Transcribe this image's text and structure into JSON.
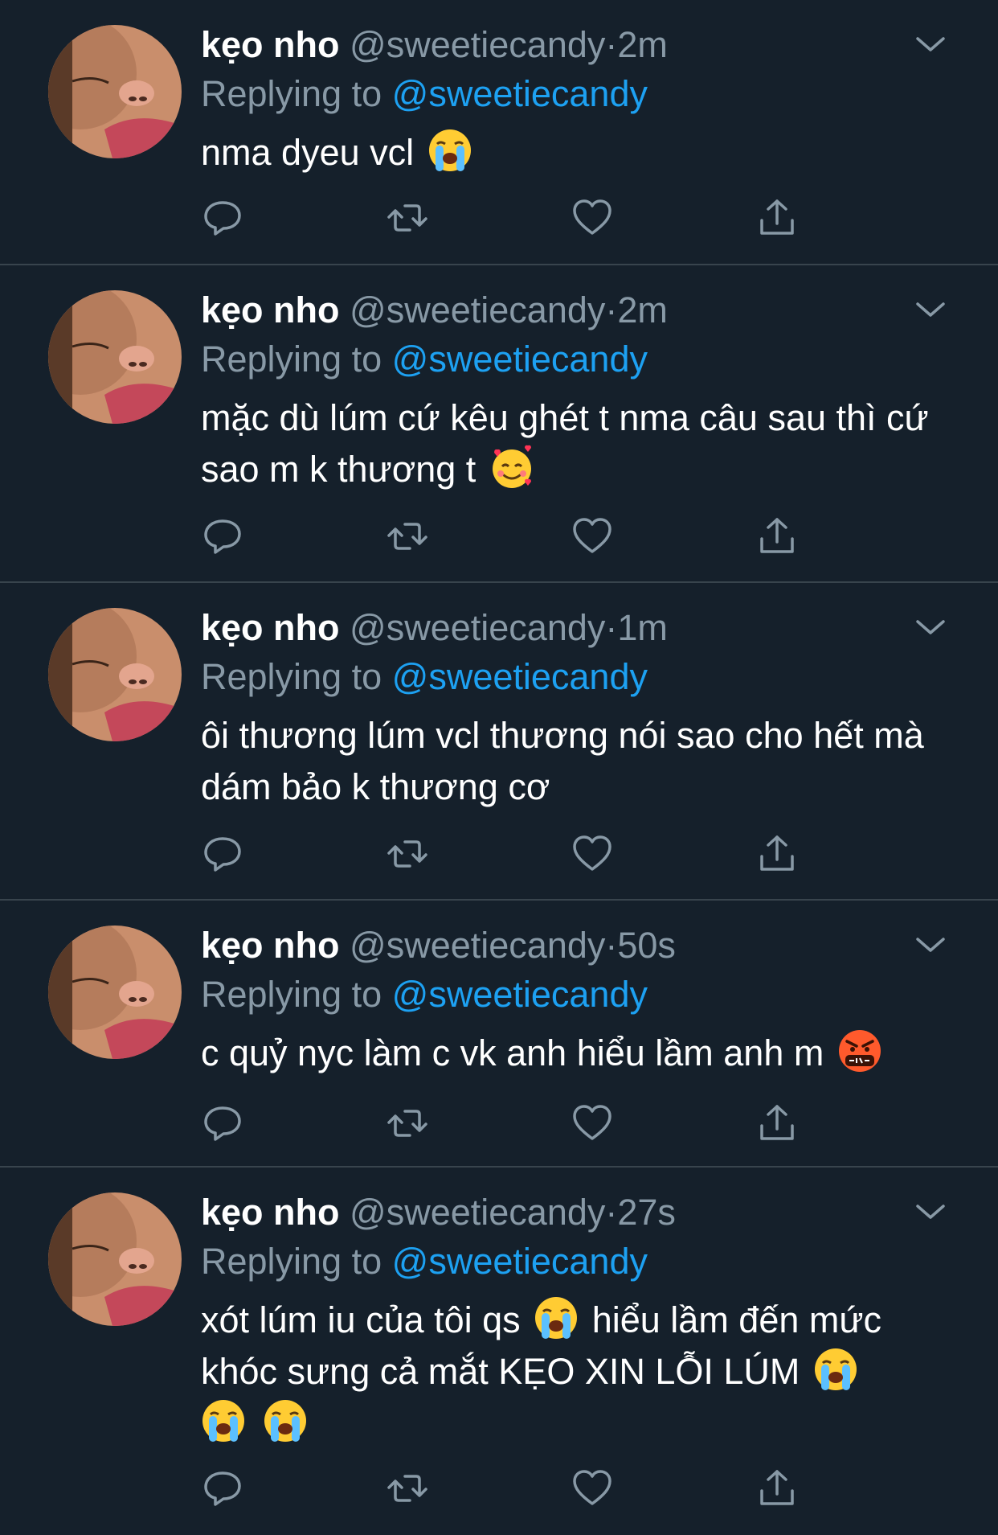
{
  "colors": {
    "background": "#15202b",
    "divider": "#38444d",
    "muted_text": "#8899a6",
    "link": "#1da1f2",
    "text": "#ffffff"
  },
  "tweets": [
    {
      "name": "kẹo nho",
      "handle": "@sweetiecandy",
      "separator": "·",
      "time": "2m",
      "replying_prefix": "Replying to ",
      "replying_to": "@sweetiecandy",
      "text_parts": [
        "nma dyeu vcl"
      ],
      "emojis": [
        "loudly-crying-face-emoji"
      ]
    },
    {
      "name": "kẹo nho",
      "handle": "@sweetiecandy",
      "separator": "·",
      "time": "2m",
      "replying_prefix": "Replying to ",
      "replying_to": "@sweetiecandy",
      "text_parts": [
        "mặc dù lúm cứ kêu ghét t nma câu sau thì cứ sao m k thương t"
      ],
      "emojis": [
        "smiling-face-with-hearts-emoji"
      ]
    },
    {
      "name": "kẹo nho",
      "handle": "@sweetiecandy",
      "separator": "·",
      "time": "1m",
      "replying_prefix": "Replying to ",
      "replying_to": "@sweetiecandy",
      "text_parts": [
        "ôi thương lúm vcl thương nói sao cho hết mà dám bảo k thương cơ"
      ],
      "emojis": []
    },
    {
      "name": "kẹo nho",
      "handle": "@sweetiecandy",
      "separator": "·",
      "time": "50s",
      "replying_prefix": "Replying to ",
      "replying_to": "@sweetiecandy",
      "text_parts": [
        "c quỷ nyc làm c vk anh hiểu lầm anh m"
      ],
      "emojis": [
        "face-with-symbols-on-mouth-emoji"
      ]
    },
    {
      "name": "kẹo nho",
      "handle": "@sweetiecandy",
      "separator": "·",
      "time": "27s",
      "replying_prefix": "Replying to ",
      "replying_to": "@sweetiecandy",
      "text_parts": [
        "xót lúm iu của tôi qs",
        "hiểu lầm đến mức khóc sưng cả mắt KẸO XIN LỖI LÚM"
      ],
      "emojis": [
        "loudly-crying-face-emoji",
        "loudly-crying-face-emoji",
        "loudly-crying-face-emoji",
        "loudly-crying-face-emoji"
      ]
    }
  ],
  "actions": [
    "reply-icon",
    "retweet-icon",
    "like-icon",
    "share-icon"
  ]
}
